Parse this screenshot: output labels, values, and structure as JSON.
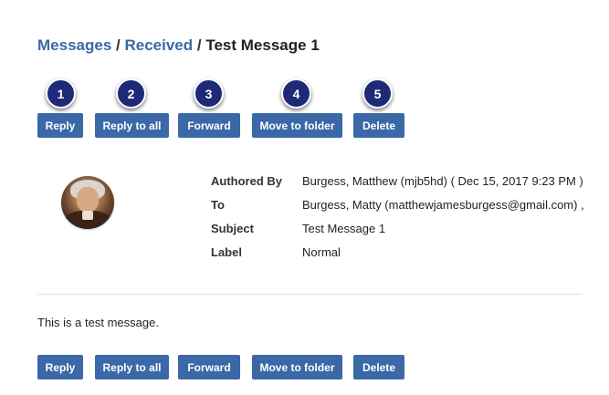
{
  "breadcrumb": {
    "messages": "Messages",
    "separator": "/",
    "received": "Received",
    "current": "Test Message 1"
  },
  "markers": [
    "1",
    "2",
    "3",
    "4",
    "5"
  ],
  "toolbar": {
    "reply": "Reply",
    "reply_all": "Reply to all",
    "forward": "Forward",
    "move_to_folder": "Move to folder",
    "delete": "Delete"
  },
  "message": {
    "labels": {
      "authored_by": "Authored By",
      "to": "To",
      "subject": "Subject",
      "label": "Label"
    },
    "authored_by": "Burgess, Matthew (mjb5hd) ( Dec 15, 2017 9:23 PM )",
    "to": "Burgess, Matty (matthewjamesburgess@gmail.com) ,",
    "subject": "Test Message 1",
    "label": "Normal",
    "body": "This is a test message."
  },
  "colors": {
    "link": "#3a69a3",
    "button": "#3b68a6",
    "marker": "#1e2a78"
  }
}
